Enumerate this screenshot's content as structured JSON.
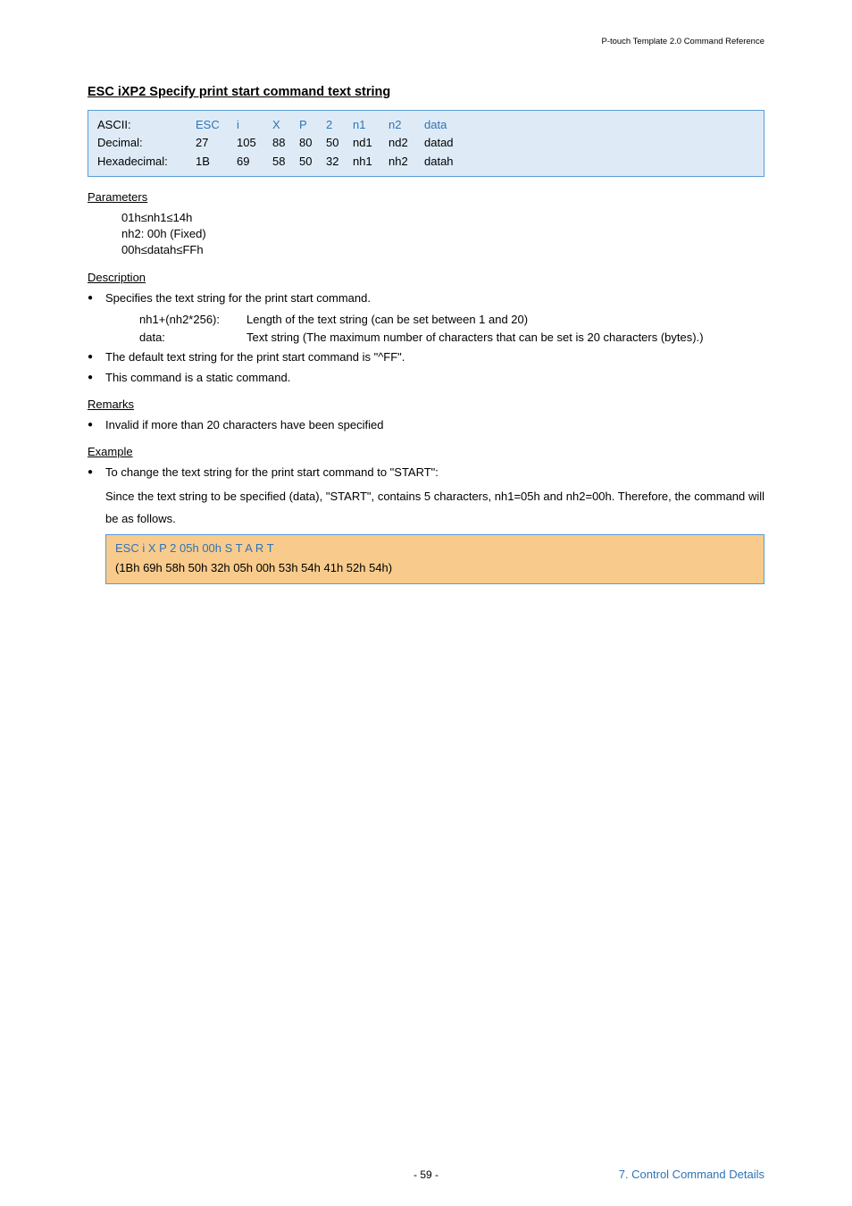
{
  "header": {
    "right": "P-touch Template 2.0 Command Reference"
  },
  "title": "ESC iXP2   Specify print start command text string",
  "codebox": {
    "rows": [
      {
        "label": "ASCII:",
        "cols": [
          "ESC",
          "i",
          "X",
          "P",
          "2",
          "n1",
          "n2",
          "data"
        ],
        "blue": true
      },
      {
        "label": "Decimal:",
        "cols": [
          "27",
          "105",
          "88",
          "80",
          "50",
          "nd1",
          "nd2",
          "datad"
        ],
        "blue": false
      },
      {
        "label": "Hexadecimal:",
        "cols": [
          "1B",
          "69",
          "58",
          "50",
          "32",
          "nh1",
          "nh2",
          "datah"
        ],
        "blue": false
      }
    ]
  },
  "parameters": {
    "heading": "Parameters",
    "lines": [
      "01h≤nh1≤14h",
      "nh2: 00h (Fixed)",
      "00h≤datah≤FFh"
    ]
  },
  "description": {
    "heading": "Description",
    "bullets": [
      {
        "text": "Specifies the text string for the print start command.",
        "kv": [
          {
            "k": "nh1+(nh2*256):",
            "v": "Length of the text string (can be set between 1 and 20)"
          },
          {
            "k": "data:",
            "v": "Text string (The maximum number of characters that can be set is 20 characters (bytes).)"
          }
        ]
      },
      {
        "text": "The default text string for the print start command is \"^FF\"."
      },
      {
        "text": "This command is a static command."
      }
    ]
  },
  "remarks": {
    "heading": "Remarks",
    "bullets": [
      {
        "text": "Invalid if more than 20 characters have been specified"
      }
    ]
  },
  "example": {
    "heading": "Example",
    "bullets": [
      {
        "text": "To change the text string for the print start command to \"START\":",
        "para": "Since the text string to be specified (data), \"START\", contains 5 characters, nh1=05h and nh2=00h. Therefore, the command will be as follows."
      }
    ],
    "box": {
      "line1": "ESC i X P 2 05h 00h S T A R T",
      "line2": "(1Bh 69h 58h 50h 32h 05h 00h 53h 54h 41h 52h 54h)"
    }
  },
  "footer": {
    "center": "- 59 -",
    "right": "7. Control Command Details"
  }
}
